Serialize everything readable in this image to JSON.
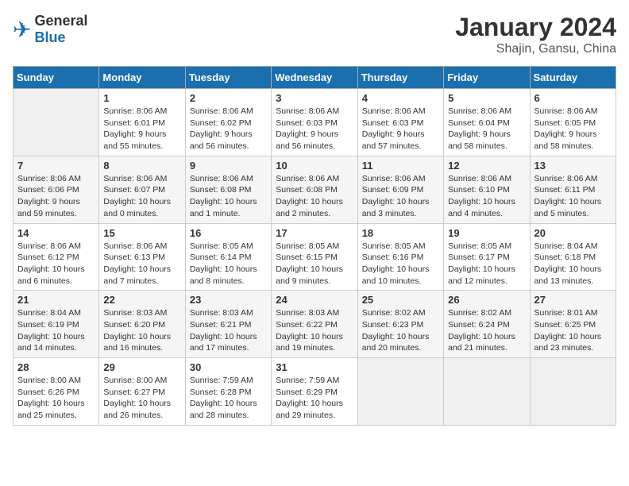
{
  "header": {
    "logo": {
      "general": "General",
      "blue": "Blue"
    },
    "title": "January 2024",
    "location": "Shajin, Gansu, China"
  },
  "weekdays": [
    "Sunday",
    "Monday",
    "Tuesday",
    "Wednesday",
    "Thursday",
    "Friday",
    "Saturday"
  ],
  "weeks": [
    [
      {
        "day": null
      },
      {
        "day": "1",
        "sunrise": "Sunrise: 8:06 AM",
        "sunset": "Sunset: 6:01 PM",
        "daylight": "Daylight: 9 hours and 55 minutes."
      },
      {
        "day": "2",
        "sunrise": "Sunrise: 8:06 AM",
        "sunset": "Sunset: 6:02 PM",
        "daylight": "Daylight: 9 hours and 56 minutes."
      },
      {
        "day": "3",
        "sunrise": "Sunrise: 8:06 AM",
        "sunset": "Sunset: 6:03 PM",
        "daylight": "Daylight: 9 hours and 56 minutes."
      },
      {
        "day": "4",
        "sunrise": "Sunrise: 8:06 AM",
        "sunset": "Sunset: 6:03 PM",
        "daylight": "Daylight: 9 hours and 57 minutes."
      },
      {
        "day": "5",
        "sunrise": "Sunrise: 8:06 AM",
        "sunset": "Sunset: 6:04 PM",
        "daylight": "Daylight: 9 hours and 58 minutes."
      },
      {
        "day": "6",
        "sunrise": "Sunrise: 8:06 AM",
        "sunset": "Sunset: 6:05 PM",
        "daylight": "Daylight: 9 hours and 58 minutes."
      }
    ],
    [
      {
        "day": "7",
        "sunrise": "Sunrise: 8:06 AM",
        "sunset": "Sunset: 6:06 PM",
        "daylight": "Daylight: 9 hours and 59 minutes."
      },
      {
        "day": "8",
        "sunrise": "Sunrise: 8:06 AM",
        "sunset": "Sunset: 6:07 PM",
        "daylight": "Daylight: 10 hours and 0 minutes."
      },
      {
        "day": "9",
        "sunrise": "Sunrise: 8:06 AM",
        "sunset": "Sunset: 6:08 PM",
        "daylight": "Daylight: 10 hours and 1 minute."
      },
      {
        "day": "10",
        "sunrise": "Sunrise: 8:06 AM",
        "sunset": "Sunset: 6:08 PM",
        "daylight": "Daylight: 10 hours and 2 minutes."
      },
      {
        "day": "11",
        "sunrise": "Sunrise: 8:06 AM",
        "sunset": "Sunset: 6:09 PM",
        "daylight": "Daylight: 10 hours and 3 minutes."
      },
      {
        "day": "12",
        "sunrise": "Sunrise: 8:06 AM",
        "sunset": "Sunset: 6:10 PM",
        "daylight": "Daylight: 10 hours and 4 minutes."
      },
      {
        "day": "13",
        "sunrise": "Sunrise: 8:06 AM",
        "sunset": "Sunset: 6:11 PM",
        "daylight": "Daylight: 10 hours and 5 minutes."
      }
    ],
    [
      {
        "day": "14",
        "sunrise": "Sunrise: 8:06 AM",
        "sunset": "Sunset: 6:12 PM",
        "daylight": "Daylight: 10 hours and 6 minutes."
      },
      {
        "day": "15",
        "sunrise": "Sunrise: 8:06 AM",
        "sunset": "Sunset: 6:13 PM",
        "daylight": "Daylight: 10 hours and 7 minutes."
      },
      {
        "day": "16",
        "sunrise": "Sunrise: 8:05 AM",
        "sunset": "Sunset: 6:14 PM",
        "daylight": "Daylight: 10 hours and 8 minutes."
      },
      {
        "day": "17",
        "sunrise": "Sunrise: 8:05 AM",
        "sunset": "Sunset: 6:15 PM",
        "daylight": "Daylight: 10 hours and 9 minutes."
      },
      {
        "day": "18",
        "sunrise": "Sunrise: 8:05 AM",
        "sunset": "Sunset: 6:16 PM",
        "daylight": "Daylight: 10 hours and 10 minutes."
      },
      {
        "day": "19",
        "sunrise": "Sunrise: 8:05 AM",
        "sunset": "Sunset: 6:17 PM",
        "daylight": "Daylight: 10 hours and 12 minutes."
      },
      {
        "day": "20",
        "sunrise": "Sunrise: 8:04 AM",
        "sunset": "Sunset: 6:18 PM",
        "daylight": "Daylight: 10 hours and 13 minutes."
      }
    ],
    [
      {
        "day": "21",
        "sunrise": "Sunrise: 8:04 AM",
        "sunset": "Sunset: 6:19 PM",
        "daylight": "Daylight: 10 hours and 14 minutes."
      },
      {
        "day": "22",
        "sunrise": "Sunrise: 8:03 AM",
        "sunset": "Sunset: 6:20 PM",
        "daylight": "Daylight: 10 hours and 16 minutes."
      },
      {
        "day": "23",
        "sunrise": "Sunrise: 8:03 AM",
        "sunset": "Sunset: 6:21 PM",
        "daylight": "Daylight: 10 hours and 17 minutes."
      },
      {
        "day": "24",
        "sunrise": "Sunrise: 8:03 AM",
        "sunset": "Sunset: 6:22 PM",
        "daylight": "Daylight: 10 hours and 19 minutes."
      },
      {
        "day": "25",
        "sunrise": "Sunrise: 8:02 AM",
        "sunset": "Sunset: 6:23 PM",
        "daylight": "Daylight: 10 hours and 20 minutes."
      },
      {
        "day": "26",
        "sunrise": "Sunrise: 8:02 AM",
        "sunset": "Sunset: 6:24 PM",
        "daylight": "Daylight: 10 hours and 21 minutes."
      },
      {
        "day": "27",
        "sunrise": "Sunrise: 8:01 AM",
        "sunset": "Sunset: 6:25 PM",
        "daylight": "Daylight: 10 hours and 23 minutes."
      }
    ],
    [
      {
        "day": "28",
        "sunrise": "Sunrise: 8:00 AM",
        "sunset": "Sunset: 6:26 PM",
        "daylight": "Daylight: 10 hours and 25 minutes."
      },
      {
        "day": "29",
        "sunrise": "Sunrise: 8:00 AM",
        "sunset": "Sunset: 6:27 PM",
        "daylight": "Daylight: 10 hours and 26 minutes."
      },
      {
        "day": "30",
        "sunrise": "Sunrise: 7:59 AM",
        "sunset": "Sunset: 6:28 PM",
        "daylight": "Daylight: 10 hours and 28 minutes."
      },
      {
        "day": "31",
        "sunrise": "Sunrise: 7:59 AM",
        "sunset": "Sunset: 6:29 PM",
        "daylight": "Daylight: 10 hours and 29 minutes."
      },
      {
        "day": null
      },
      {
        "day": null
      },
      {
        "day": null
      }
    ]
  ]
}
